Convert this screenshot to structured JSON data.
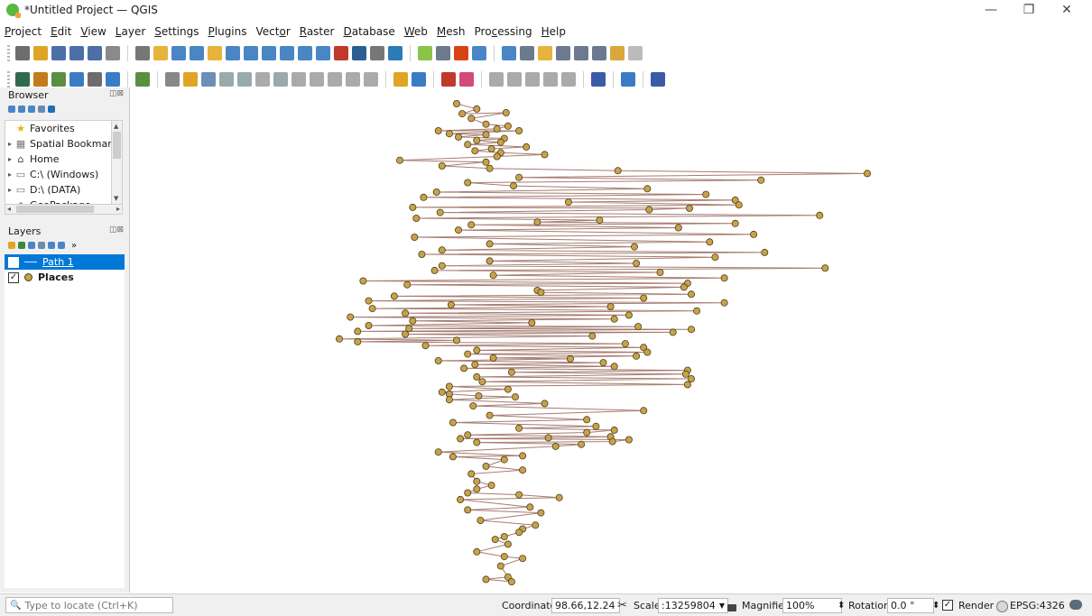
{
  "window": {
    "title": "*Untitled Project — QGIS",
    "controls": {
      "minimize": "—",
      "maximize": "❐",
      "close": "✕"
    }
  },
  "menu": {
    "items": [
      {
        "pre": "",
        "u": "P",
        "post": "roject"
      },
      {
        "pre": "",
        "u": "E",
        "post": "dit"
      },
      {
        "pre": "",
        "u": "V",
        "post": "iew"
      },
      {
        "pre": "",
        "u": "L",
        "post": "ayer"
      },
      {
        "pre": "",
        "u": "S",
        "post": "ettings"
      },
      {
        "pre": "",
        "u": "P",
        "post": "lugins"
      },
      {
        "pre": "Vect",
        "u": "o",
        "post": "r"
      },
      {
        "pre": "",
        "u": "R",
        "post": "aster"
      },
      {
        "pre": "",
        "u": "D",
        "post": "atabase"
      },
      {
        "pre": "",
        "u": "W",
        "post": "eb"
      },
      {
        "pre": "",
        "u": "M",
        "post": "esh"
      },
      {
        "pre": "Pro",
        "u": "c",
        "post": "essing"
      },
      {
        "pre": "",
        "u": "H",
        "post": "elp"
      }
    ]
  },
  "toolbar1_colors": [
    "#6d6d6d",
    "#e0a526",
    "#4c6fa8",
    "#4c6fa8",
    "#4c6fa8",
    "#8a8a8a",
    "sep",
    "#777",
    "#e6b33c",
    "#4a86c5",
    "#4a86c5",
    "#e6b33c",
    "#4a86c5",
    "#4a86c5",
    "#4a86c5",
    "#4a86c5",
    "#4a86c5",
    "#4a86c5",
    "#c0392b",
    "#2c5f91",
    "#777",
    "#2b7bb9",
    "sep",
    "#8bc34a",
    "#6b7a8f",
    "#d84315",
    "#4a86c5",
    "sep",
    "#4a86c5",
    "#6b7a8f",
    "#e6b33c",
    "#6b7a8f",
    "#6b7a8f",
    "#6b7a8f",
    "#d9a73a",
    "#bbbbbb"
  ],
  "toolbar2_colors": [
    "#2f6a4f",
    "#c47b1d",
    "#5b8e3e",
    "#3a7cc4",
    "#6d6d6d",
    "#3a7cc4",
    "sep",
    "#5b8e3e",
    "sep",
    "#888",
    "#e0a526",
    "#6b8fb8",
    "#9aa",
    "#9aa",
    "#aaa",
    "#9aa",
    "#aaa",
    "#aaa",
    "#aaa",
    "#aaa",
    "#aaa",
    "sep",
    "#e0a526",
    "#3a7cc4",
    "sep",
    "#c0392b",
    "#d14a7a",
    "sep",
    "#aaa",
    "#aaa",
    "#aaa",
    "#aaa",
    "#aaa",
    "sep",
    "#3a5ca8",
    "sep",
    "#3a7cc4",
    "sep",
    "#3a5ca8"
  ],
  "browser": {
    "title": "Browser",
    "controls": "◫⊠",
    "items": [
      {
        "label": "Favorites",
        "icon": "★",
        "color": "#e8b400",
        "arrow": ""
      },
      {
        "label": "Spatial Bookmar",
        "icon": "▦",
        "color": "#777",
        "arrow": "▸"
      },
      {
        "label": "Home",
        "icon": "⌂",
        "color": "#444",
        "arrow": "▸"
      },
      {
        "label": "C:\\ (Windows)",
        "icon": "▭",
        "color": "#777",
        "arrow": "▸"
      },
      {
        "label": "D:\\ (DATA)",
        "icon": "▭",
        "color": "#777",
        "arrow": "▸"
      },
      {
        "label": "GeoPackage",
        "icon": "◆",
        "color": "#7aa63c",
        "arrow": ""
      }
    ],
    "tool_colors": [
      "#4a86c5",
      "#4a86c5",
      "#4a86c5",
      "#6a8bb0",
      "#1a6fb5"
    ]
  },
  "layers": {
    "title": "Layers",
    "controls": "◫⊠",
    "tool_colors": [
      "#e0a526",
      "#3c8a3c",
      "#4a86c5",
      "#6a8bb0",
      "#4a86c5",
      "#4a86c5"
    ],
    "more": "»",
    "items": [
      {
        "label": "Path 1",
        "checked": "✓",
        "selected": true
      },
      {
        "label": "Places",
        "checked": "✓",
        "selected": false
      }
    ]
  },
  "map": {
    "point_color": "#c8a24a",
    "point_stroke": "#4d3f18",
    "line_color": "#a57c70",
    "points": [
      [
        98.44,
        23.41
      ],
      [
        98.55,
        23.3
      ],
      [
        98.47,
        23.2
      ],
      [
        98.71,
        23.22
      ],
      [
        98.52,
        23.1
      ],
      [
        98.6,
        22.98
      ],
      [
        98.72,
        22.94
      ],
      [
        98.66,
        22.88
      ],
      [
        98.34,
        22.84
      ],
      [
        98.78,
        22.84
      ],
      [
        98.4,
        22.78
      ],
      [
        98.6,
        22.76
      ],
      [
        98.45,
        22.71
      ],
      [
        98.7,
        22.68
      ],
      [
        98.55,
        22.64
      ],
      [
        98.68,
        22.6
      ],
      [
        98.5,
        22.55
      ],
      [
        98.82,
        22.5
      ],
      [
        98.63,
        22.46
      ],
      [
        98.54,
        22.42
      ],
      [
        98.68,
        22.38
      ],
      [
        98.92,
        22.34
      ],
      [
        98.66,
        22.3
      ],
      [
        98.13,
        22.22
      ],
      [
        98.6,
        22.18
      ],
      [
        98.36,
        22.1
      ],
      [
        98.62,
        22.05
      ],
      [
        99.32,
        22.0
      ],
      [
        100.68,
        21.94
      ],
      [
        98.78,
        21.86
      ],
      [
        100.1,
        21.8
      ],
      [
        98.5,
        21.75
      ],
      [
        98.75,
        21.68
      ],
      [
        99.48,
        21.62
      ],
      [
        98.33,
        21.55
      ],
      [
        99.8,
        21.5
      ],
      [
        98.26,
        21.44
      ],
      [
        99.96,
        21.38
      ],
      [
        99.05,
        21.34
      ],
      [
        99.98,
        21.28
      ],
      [
        98.2,
        21.23
      ],
      [
        99.71,
        21.21
      ],
      [
        99.49,
        21.18
      ],
      [
        98.35,
        21.12
      ],
      [
        100.42,
        21.06
      ],
      [
        98.22,
        21.0
      ],
      [
        99.22,
        20.96
      ],
      [
        98.88,
        20.92
      ],
      [
        99.96,
        20.89
      ],
      [
        98.52,
        20.86
      ],
      [
        99.65,
        20.8
      ],
      [
        98.45,
        20.75
      ],
      [
        100.06,
        20.66
      ],
      [
        98.21,
        20.6
      ],
      [
        99.82,
        20.5
      ],
      [
        98.62,
        20.46
      ],
      [
        99.41,
        20.4
      ],
      [
        98.36,
        20.33
      ],
      [
        100.12,
        20.28
      ],
      [
        98.25,
        20.24
      ],
      [
        99.85,
        20.18
      ],
      [
        98.62,
        20.1
      ],
      [
        99.42,
        20.05
      ],
      [
        98.36,
        20.0
      ],
      [
        100.45,
        19.95
      ],
      [
        98.32,
        19.9
      ],
      [
        99.55,
        19.86
      ],
      [
        98.64,
        19.8
      ],
      [
        99.9,
        19.74
      ],
      [
        97.93,
        19.68
      ],
      [
        99.7,
        19.63
      ],
      [
        98.17,
        19.6
      ],
      [
        99.68,
        19.55
      ],
      [
        98.88,
        19.48
      ],
      [
        98.9,
        19.44
      ],
      [
        99.72,
        19.4
      ],
      [
        98.1,
        19.36
      ],
      [
        99.46,
        19.32
      ],
      [
        97.96,
        19.26
      ],
      [
        99.9,
        19.22
      ],
      [
        98.41,
        19.18
      ],
      [
        99.28,
        19.14
      ],
      [
        97.98,
        19.1
      ],
      [
        99.75,
        19.05
      ],
      [
        98.16,
        19.0
      ],
      [
        99.38,
        18.96
      ],
      [
        97.86,
        18.92
      ],
      [
        99.3,
        18.88
      ],
      [
        98.2,
        18.84
      ],
      [
        98.85,
        18.8
      ],
      [
        97.96,
        18.74
      ],
      [
        99.43,
        18.72
      ],
      [
        98.18,
        18.68
      ],
      [
        99.72,
        18.66
      ],
      [
        97.9,
        18.62
      ],
      [
        99.62,
        18.6
      ],
      [
        98.16,
        18.56
      ],
      [
        99.18,
        18.52
      ],
      [
        97.8,
        18.46
      ],
      [
        98.44,
        18.43
      ],
      [
        97.9,
        18.4
      ],
      [
        99.36,
        18.36
      ],
      [
        98.27,
        18.32
      ],
      [
        99.46,
        18.28
      ],
      [
        98.55,
        18.22
      ],
      [
        99.48,
        18.18
      ],
      [
        98.5,
        18.14
      ],
      [
        99.42,
        18.1
      ],
      [
        98.64,
        18.06
      ],
      [
        99.06,
        18.04
      ],
      [
        98.34,
        18.0
      ],
      [
        99.24,
        17.96
      ],
      [
        98.54,
        17.92
      ],
      [
        99.3,
        17.88
      ],
      [
        98.48,
        17.84
      ],
      [
        99.7,
        17.8
      ],
      [
        98.74,
        17.76
      ],
      [
        99.69,
        17.72
      ],
      [
        98.55,
        17.66
      ],
      [
        99.72,
        17.62
      ],
      [
        98.58,
        17.56
      ],
      [
        99.7,
        17.5
      ],
      [
        98.4,
        17.46
      ],
      [
        98.72,
        17.4
      ],
      [
        98.36,
        17.34
      ],
      [
        98.4,
        17.3
      ],
      [
        98.56,
        17.26
      ],
      [
        98.76,
        17.24
      ],
      [
        98.4,
        17.18
      ],
      [
        98.92,
        17.1
      ],
      [
        98.53,
        17.05
      ],
      [
        99.46,
        16.95
      ],
      [
        98.62,
        16.85
      ],
      [
        99.15,
        16.76
      ],
      [
        98.42,
        16.7
      ],
      [
        99.2,
        16.62
      ],
      [
        98.78,
        16.58
      ],
      [
        99.3,
        16.54
      ],
      [
        99.15,
        16.49
      ],
      [
        98.5,
        16.44
      ],
      [
        99.28,
        16.4
      ],
      [
        98.94,
        16.38
      ],
      [
        98.46,
        16.36
      ],
      [
        99.38,
        16.34
      ],
      [
        99.29,
        16.3
      ],
      [
        98.55,
        16.28
      ],
      [
        99.12,
        16.24
      ],
      [
        98.98,
        16.2
      ],
      [
        98.34,
        16.08
      ],
      [
        98.8,
        16.0
      ],
      [
        98.42,
        15.98
      ],
      [
        98.7,
        15.92
      ],
      [
        98.6,
        15.78
      ],
      [
        98.8,
        15.7
      ],
      [
        98.52,
        15.62
      ],
      [
        98.55,
        15.46
      ],
      [
        98.63,
        15.38
      ],
      [
        98.55,
        15.3
      ],
      [
        98.5,
        15.22
      ],
      [
        98.78,
        15.18
      ],
      [
        99.0,
        15.12
      ],
      [
        98.46,
        15.08
      ],
      [
        98.84,
        14.92
      ],
      [
        98.5,
        14.86
      ],
      [
        98.9,
        14.8
      ],
      [
        98.57,
        14.64
      ],
      [
        98.87,
        14.54
      ],
      [
        98.8,
        14.46
      ],
      [
        98.78,
        14.39
      ],
      [
        98.7,
        14.3
      ],
      [
        98.65,
        14.24
      ],
      [
        98.72,
        14.14
      ],
      [
        98.55,
        13.98
      ],
      [
        98.7,
        13.88
      ],
      [
        98.8,
        13.84
      ],
      [
        98.68,
        13.68
      ],
      [
        98.72,
        13.45
      ],
      [
        98.6,
        13.4
      ],
      [
        98.74,
        13.35
      ]
    ]
  },
  "status": {
    "locator_icon": "🔍",
    "locator_placeholder": "Type to locate (Ctrl+K)",
    "coordinate_label": "Coordinate",
    "coordinate_value": "98.66,12.24",
    "scale_label": "Scale",
    "scale_value": ":13259804",
    "magnifier_label": "Magnifier",
    "magnifier_value": "100%",
    "rotation_label": "Rotation",
    "rotation_value": "0.0 °",
    "render_label": "Render",
    "render_checked": "✓",
    "crs": "EPSG:4326",
    "dropdown_arrow": "▼",
    "spin_arrow": "⬍"
  }
}
